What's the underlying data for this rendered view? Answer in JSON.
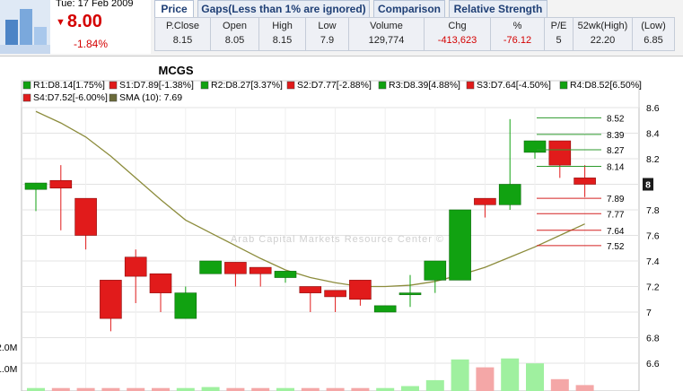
{
  "header": {
    "date": "Tue: 17 Feb 2009",
    "price": "8.00",
    "change_pct": "-1.84%"
  },
  "tabs": [
    {
      "label": "Price",
      "active": true
    },
    {
      "label": "Gaps(Less than 1% are ignored)",
      "active": false
    },
    {
      "label": "Comparison",
      "active": false
    },
    {
      "label": "Relative Strength",
      "active": false
    }
  ],
  "stats": [
    {
      "label": "P.Close",
      "value": "8.15"
    },
    {
      "label": "Open",
      "value": "8.05"
    },
    {
      "label": "High",
      "value": "8.15"
    },
    {
      "label": "Low",
      "value": "7.9"
    },
    {
      "label": "Volume",
      "value": "129,774"
    },
    {
      "label": "Chg",
      "value": "-413,623"
    },
    {
      "label": "%",
      "value": "-76.12"
    },
    {
      "label": "P/E",
      "value": "5"
    },
    {
      "label": "52wk(High)",
      "value": "22.20"
    },
    {
      "label": "(Low)",
      "value": "6.85"
    }
  ],
  "colors": {
    "up": "#11a211",
    "down": "#e11b1b",
    "sma": "#8c8c3c",
    "resistance": "#2c9a2c",
    "support": "#d42020",
    "accent_negative": "#d40000"
  },
  "chart_data": {
    "type": "candlestick",
    "title": "MCGS",
    "watermark": "Arab Capital Markets Resource Center ©",
    "legend": [
      {
        "label": "R1:D8.14[1.75%]",
        "color": "#11a211"
      },
      {
        "label": "S1:D7.89[-1.38%]",
        "color": "#e11b1b"
      },
      {
        "label": "R2:D8.27[3.37%]",
        "color": "#11a211"
      },
      {
        "label": "S2:D7.77[-2.88%]",
        "color": "#e11b1b"
      },
      {
        "label": "R3:D8.39[4.88%]",
        "color": "#11a211"
      },
      {
        "label": "S3:D7.64[-4.50%]",
        "color": "#e11b1b"
      },
      {
        "label": "R4:D8.52[6.50%]",
        "color": "#11a211"
      },
      {
        "label": "S4:D7.52[-6.00%]",
        "color": "#e11b1b"
      },
      {
        "label": "SMA (10): 7.69",
        "color": "#6b6b3a"
      }
    ],
    "y_ticks": [
      "8.6",
      "8.4",
      "8.2",
      "8",
      "7.8",
      "7.6",
      "7.4",
      "7.2",
      "7",
      "6.8",
      "6.6"
    ],
    "y_range": [
      6.48,
      8.68
    ],
    "current_price": "8",
    "volume_labels": [
      "2.0M",
      "1.0M"
    ],
    "candles": [
      {
        "o": 7.96,
        "h": 8.01,
        "l": 7.79,
        "c": 8.01
      },
      {
        "o": 8.03,
        "h": 8.15,
        "l": 7.64,
        "c": 7.97
      },
      {
        "o": 7.89,
        "h": 7.89,
        "l": 7.49,
        "c": 7.6
      },
      {
        "o": 7.25,
        "h": 7.25,
        "l": 6.85,
        "c": 6.95
      },
      {
        "o": 7.43,
        "h": 7.49,
        "l": 7.07,
        "c": 7.28
      },
      {
        "o": 7.3,
        "h": 7.3,
        "l": 7.0,
        "c": 7.15
      },
      {
        "o": 6.95,
        "h": 7.2,
        "l": 6.95,
        "c": 7.15
      },
      {
        "o": 7.3,
        "h": 7.4,
        "l": 7.3,
        "c": 7.4
      },
      {
        "o": 7.39,
        "h": 7.39,
        "l": 7.2,
        "c": 7.3
      },
      {
        "o": 7.35,
        "h": 7.35,
        "l": 7.2,
        "c": 7.3
      },
      {
        "o": 7.27,
        "h": 7.32,
        "l": 7.23,
        "c": 7.32
      },
      {
        "o": 7.2,
        "h": 7.2,
        "l": 7.0,
        "c": 7.15
      },
      {
        "o": 7.17,
        "h": 7.17,
        "l": 7.0,
        "c": 7.12
      },
      {
        "o": 7.25,
        "h": 7.25,
        "l": 7.05,
        "c": 7.1
      },
      {
        "o": 7.0,
        "h": 7.05,
        "l": 7.0,
        "c": 7.05
      },
      {
        "o": 7.15,
        "h": 7.29,
        "l": 7.04,
        "c": 7.15
      },
      {
        "o": 7.25,
        "h": 7.4,
        "l": 7.15,
        "c": 7.4
      },
      {
        "o": 7.25,
        "h": 7.8,
        "l": 7.25,
        "c": 7.8
      },
      {
        "o": 7.89,
        "h": 7.89,
        "l": 7.74,
        "c": 7.84
      },
      {
        "o": 7.84,
        "h": 8.51,
        "l": 7.8,
        "c": 8.0
      },
      {
        "o": 8.25,
        "h": 8.34,
        "l": 8.2,
        "c": 8.34
      },
      {
        "o": 8.34,
        "h": 8.34,
        "l": 8.05,
        "c": 8.15
      },
      {
        "o": 8.05,
        "h": 8.15,
        "l": 7.9,
        "c": 8.0
      }
    ],
    "sma": [
      8.57,
      8.48,
      8.37,
      8.22,
      8.05,
      7.88,
      7.72,
      7.62,
      7.52,
      7.42,
      7.33,
      7.27,
      7.23,
      7.2,
      7.2,
      7.21,
      7.24,
      7.29,
      7.35,
      7.43,
      7.51,
      7.6,
      7.69
    ],
    "pivots": [
      {
        "name": "R4",
        "value": 8.52,
        "label": "8.52",
        "kind": "resistance"
      },
      {
        "name": "R3",
        "value": 8.39,
        "label": "8.39",
        "kind": "resistance"
      },
      {
        "name": "R2",
        "value": 8.27,
        "label": "8.27",
        "kind": "resistance"
      },
      {
        "name": "R1",
        "value": 8.14,
        "label": "8.14",
        "kind": "resistance"
      },
      {
        "name": "S1",
        "value": 7.89,
        "label": "7.89",
        "kind": "support"
      },
      {
        "name": "S2",
        "value": 7.77,
        "label": "7.77",
        "kind": "support"
      },
      {
        "name": "S3",
        "value": 7.64,
        "label": "7.64",
        "kind": "support"
      },
      {
        "name": "S4",
        "value": 7.52,
        "label": "7.52",
        "kind": "support"
      }
    ],
    "volume": [
      0.15,
      0.15,
      0.15,
      0.15,
      0.15,
      0.15,
      0.15,
      0.2,
      0.15,
      0.15,
      0.15,
      0.15,
      0.15,
      0.15,
      0.15,
      0.25,
      0.55,
      1.6,
      1.2,
      1.65,
      1.4,
      0.6,
      0.3
    ]
  }
}
